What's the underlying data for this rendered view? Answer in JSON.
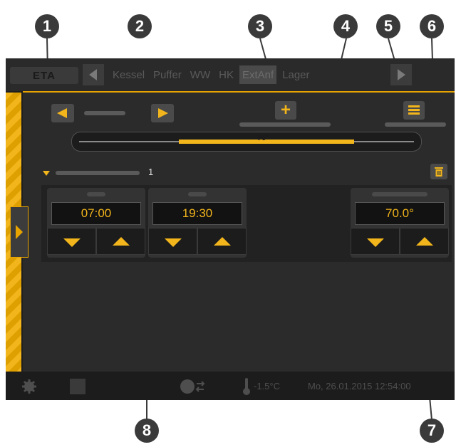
{
  "callouts": [
    "1",
    "2",
    "3",
    "4",
    "5",
    "6",
    "7",
    "8"
  ],
  "header": {
    "logo": "ETA",
    "tabs": [
      "Kessel",
      "Puffer",
      "WW",
      "HK",
      "ExtAnf",
      "Lager"
    ],
    "active_tab": "ExtAnf"
  },
  "slider": {
    "label": "70°"
  },
  "list": {
    "row_number": "1"
  },
  "times": {
    "start": "07:00",
    "end": "19:30"
  },
  "temperature": {
    "value": "70.0°"
  },
  "statusbar": {
    "outside_temp": "-1.5°C",
    "datetime": "Mo, 26.01.2015 12:54:00"
  },
  "colors": {
    "accent": "#f2b51b",
    "background": "#1e1e1e",
    "callout": "#3a3a3a"
  },
  "icons": [
    "settings-gear-icon",
    "globe-sync-icon",
    "thermometer-icon",
    "trash-icon",
    "list-icon",
    "plus-icon"
  ]
}
